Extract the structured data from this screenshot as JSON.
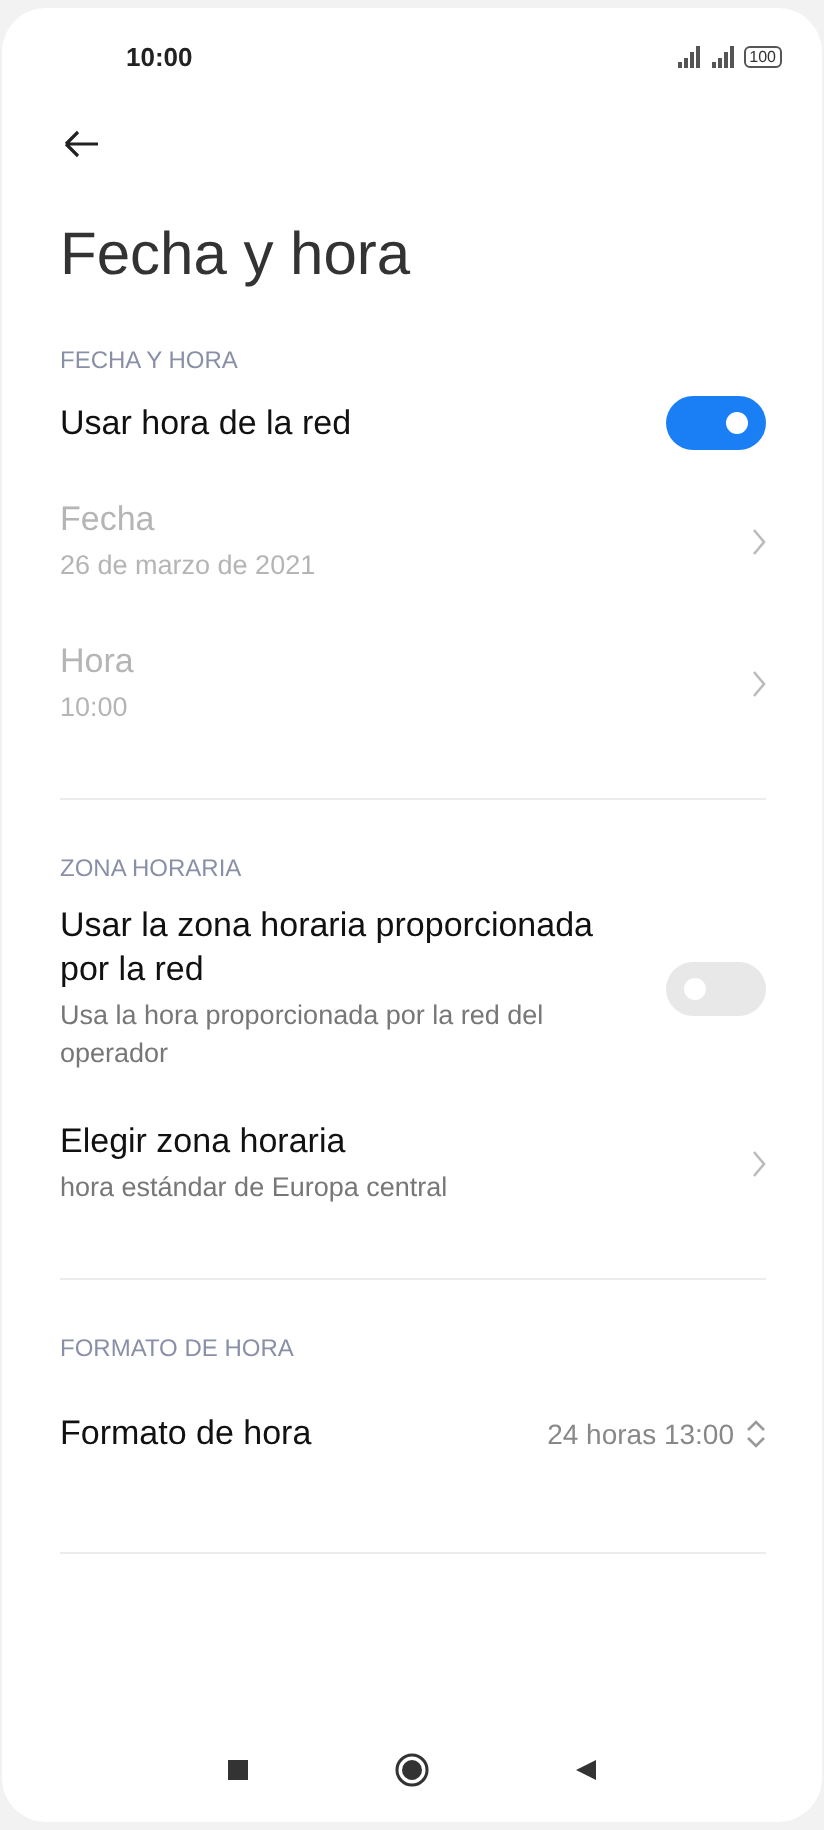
{
  "status_bar": {
    "time": "10:00",
    "battery": "100"
  },
  "title": "Fecha y hora",
  "sections": [
    {
      "header": "FECHA Y HORA",
      "items": [
        {
          "kind": "toggle",
          "title": "Usar hora de la red",
          "on": true,
          "disabled": false
        },
        {
          "kind": "link",
          "title": "Fecha",
          "subtitle": "26 de marzo de 2021",
          "disabled": true
        },
        {
          "kind": "link",
          "title": "Hora",
          "subtitle": "10:00",
          "disabled": true
        }
      ]
    },
    {
      "header": "ZONA HORARIA",
      "items": [
        {
          "kind": "toggle",
          "title": "Usar la zona horaria proporcionada por la red",
          "subtitle": "Usa la hora proporcionada por la red del operador",
          "on": false,
          "disabled": false
        },
        {
          "kind": "link",
          "title": "Elegir zona horaria",
          "subtitle": "hora estándar de Europa central",
          "disabled": false
        }
      ]
    },
    {
      "header": "FORMATO DE HORA",
      "items": [
        {
          "kind": "select",
          "title": "Formato de hora",
          "value": "24 horas 13:00",
          "disabled": false
        }
      ]
    }
  ]
}
